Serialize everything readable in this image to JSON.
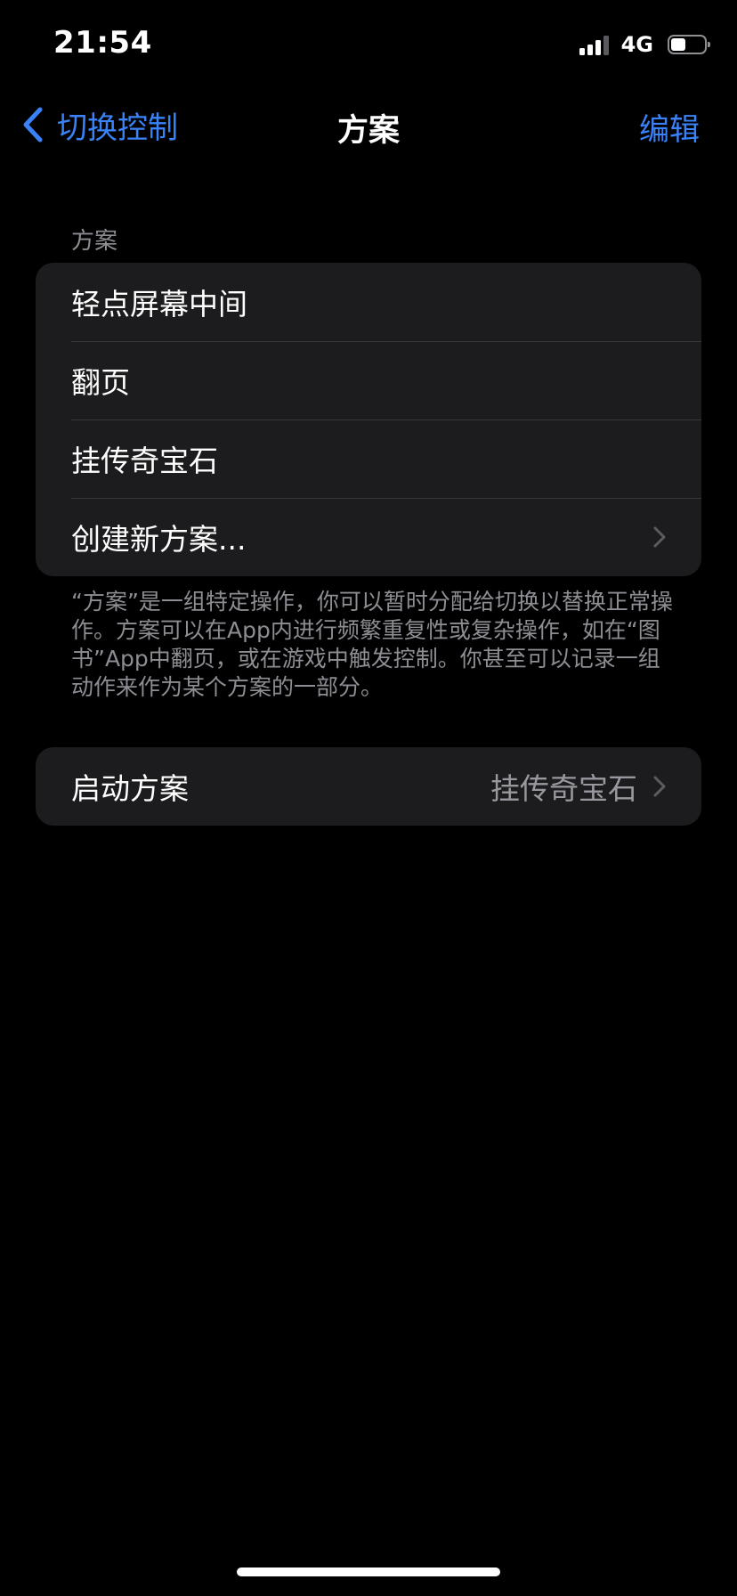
{
  "status_bar": {
    "time": "21:54",
    "network": "4G",
    "battery_level": 0.45
  },
  "nav": {
    "back_label": "切换控制",
    "title": "方案",
    "edit_label": "编辑"
  },
  "recipes_section": {
    "header": "方案",
    "items": [
      {
        "label": "轻点屏幕中间"
      },
      {
        "label": "翻页"
      },
      {
        "label": "挂传奇宝石"
      },
      {
        "label": "创建新方案..."
      }
    ],
    "footer": "“方案”是一组特定操作，你可以暂时分配给切换以替换正常操作。方案可以在App内进行频繁重复性或复杂操作，如在“图书”App中翻页，或在游戏中触发控制。你甚至可以记录一组动作来作为某个方案的一部分。"
  },
  "launch_section": {
    "label": "启动方案",
    "value": "挂传奇宝石"
  },
  "colors": {
    "accent": "#3a82f7",
    "background": "#000000",
    "cell_background": "#1c1c1e",
    "secondary_text": "#8d8d93"
  }
}
